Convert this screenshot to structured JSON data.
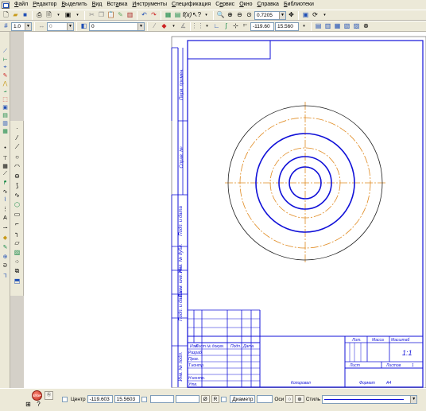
{
  "menubar": {
    "items": [
      {
        "pre": "",
        "u": "Ф",
        "post": "айл"
      },
      {
        "pre": "",
        "u": "Р",
        "post": "едактор"
      },
      {
        "pre": "",
        "u": "В",
        "post": "ыделить"
      },
      {
        "pre": "",
        "u": "В",
        "post": "ид"
      },
      {
        "pre": "Вст",
        "u": "а",
        "post": "вка"
      },
      {
        "pre": "",
        "u": "И",
        "post": "нструменты"
      },
      {
        "pre": "",
        "u": "С",
        "post": "пецификация"
      },
      {
        "pre": "С",
        "u": "е",
        "post": "рвис"
      },
      {
        "pre": "",
        "u": "О",
        "post": "кно"
      },
      {
        "pre": "",
        "u": "С",
        "post": "правка"
      },
      {
        "pre": "",
        "u": "Б",
        "post": "иблиотеки"
      }
    ]
  },
  "toolbar1": {
    "zoom_value": "0.7205"
  },
  "toolbar2": {
    "step_value": "1.0",
    "style_value": "0",
    "layer_value": "0",
    "coord_x": "-119.60",
    "coord_y": "15.560"
  },
  "drawing": {
    "side_labels": [
      "Перв. примен.",
      "Справ. №",
      "Подп. и дата",
      "Инв. № дубл.",
      "Взам. инв. №",
      "Подп. и дата",
      "Инв. № подл."
    ],
    "stamp": {
      "lit": "Лит.",
      "massa": "Масса",
      "masshtab": "Масштаб",
      "scale_value": "1:1",
      "izm": "Изм.",
      "list": "Лист",
      "ndokum": "№ докум.",
      "podp": "Подп.",
      "data": "Дата",
      "razrab": "Разраб.",
      "prov": "Пров.",
      "tkontr": "Т.контр.",
      "nkontr": "Н.контр.",
      "utv": "Утв.",
      "list_label": "Лист",
      "listov_label": "Листов",
      "listov_value": "1",
      "kopiroval": "Копировал",
      "format": "Формат",
      "format_value": "A4"
    }
  },
  "statusbar": {
    "stop_label": "STOP",
    "center_label": "Центр",
    "center_x": "-119.603",
    "center_y": "15.5603",
    "diameter_label": "Диаметр",
    "axes_label": "Оси",
    "style_label": "Стиль"
  },
  "colors": {
    "main_line": "#1010d8",
    "axis_line": "#e08a20",
    "thin_line": "#000000",
    "canvas": "#ffffff",
    "chrome": "#ece9d8"
  }
}
